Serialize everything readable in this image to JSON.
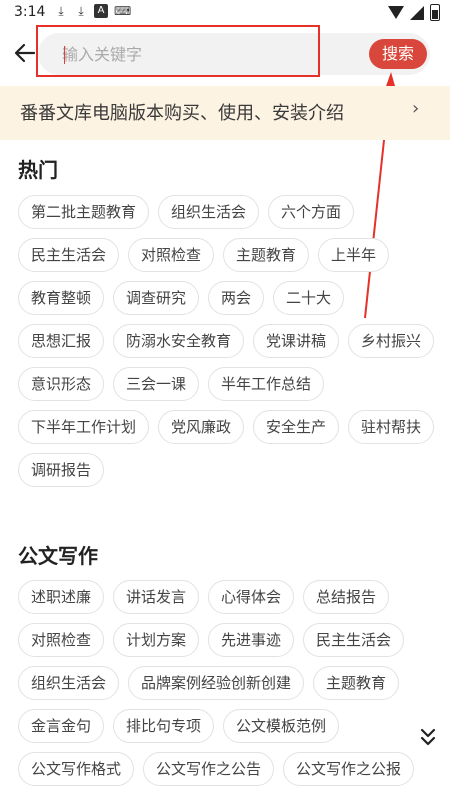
{
  "status": {
    "time": "3:14",
    "icons": [
      "download-icon",
      "download-icon",
      "text-a-icon",
      "keyboard-icon"
    ]
  },
  "search": {
    "placeholder": "输入关键字",
    "button_label": "搜索"
  },
  "banner": {
    "text": "番番文库电脑版本购买、使用、安装介绍",
    "chevron": "›"
  },
  "sections": {
    "hot": {
      "title": "热门",
      "tags": [
        "第二批主题教育",
        "组织生活会",
        "六个方面",
        "民主生活会",
        "对照检查",
        "主题教育",
        "上半年",
        "教育整顿",
        "调查研究",
        "两会",
        "二十大",
        "思想汇报",
        "防溺水安全教育",
        "党课讲稿",
        "乡村振兴",
        "意识形态",
        "三会一课",
        "半年工作总结",
        "下半年工作计划",
        "党风廉政",
        "安全生产",
        "驻村帮扶",
        "调研报告"
      ]
    },
    "writing": {
      "title": "公文写作",
      "tags": [
        "述职述廉",
        "讲话发言",
        "心得体会",
        "总结报告",
        "对照检查",
        "计划方案",
        "先进事迹",
        "民主生活会",
        "组织生活会",
        "品牌案例经验创新创建",
        "主题教育",
        "金言金句",
        "排比句专项",
        "公文模板范例",
        "公文写作格式",
        "公文写作之公告",
        "公文写作之公报"
      ]
    }
  },
  "colors": {
    "accent": "#d9463b",
    "annotation": "#e5312a",
    "banner_bg": "#fdf3e2"
  }
}
